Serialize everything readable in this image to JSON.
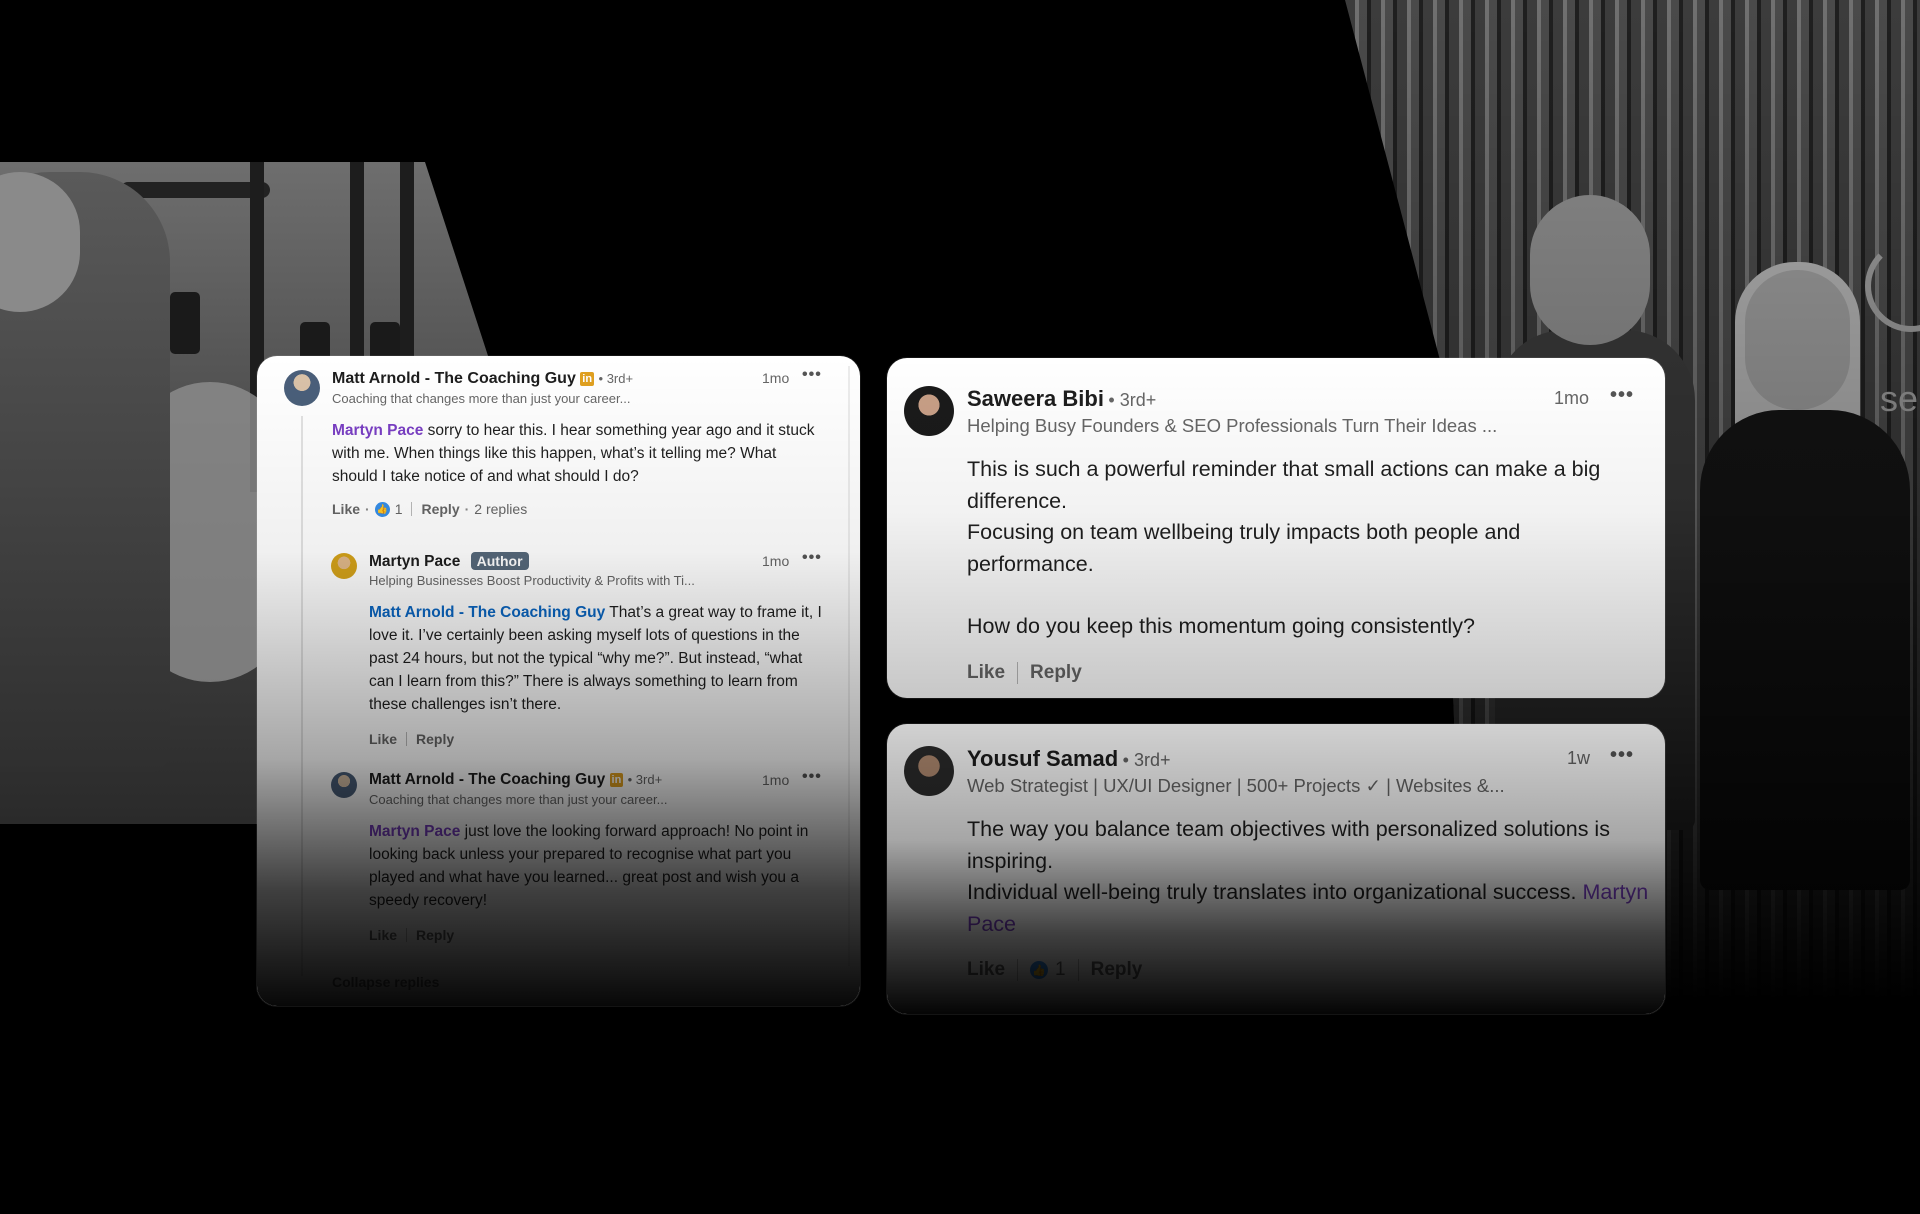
{
  "background": {
    "logo_text": "se"
  },
  "left_card": {
    "comment1": {
      "name": "Matt Arnold - The Coaching Guy",
      "linkedin_badge": "in",
      "degree": "• 3rd+",
      "headline": "Coaching that changes more than just your career...",
      "time": "1mo",
      "mention": "Martyn Pace",
      "text": " sorry to hear this. I hear something year ago and it stuck with me. When things like this happen, what’s it telling me? What should I take notice of and what should I do?",
      "like": "Like",
      "reaction_count": "1",
      "reply": "Reply",
      "replies": "2 replies"
    },
    "reply1": {
      "name": "Martyn Pace",
      "badge": "Author",
      "headline": "Helping Businesses Boost Productivity & Profits with Ti...",
      "time": "1mo",
      "mention": "Matt Arnold - The Coaching Guy",
      "text": " That’s a great way to frame it, I love it. I’ve certainly been asking myself lots of questions in the past 24 hours, but not the typical “why me?”. But instead, “what can I learn from this?” There is always something to learn from these challenges isn’t there.",
      "like": "Like",
      "reply": "Reply"
    },
    "reply2": {
      "name": "Matt Arnold - The Coaching Guy",
      "linkedin_badge": "in",
      "degree": "• 3rd+",
      "headline": "Coaching that changes more than just your career...",
      "time": "1mo",
      "mention": "Martyn Pace",
      "text": " just love the looking forward approach! No point in looking back unless your prepared to recognise what part you played and what have you learned... great post and wish you a speedy recovery!",
      "like": "Like",
      "reply": "Reply"
    },
    "collapse": "Collapse replies"
  },
  "right_top": {
    "name": "Saweera Bibi",
    "degree": "• 3rd+",
    "headline": "Helping Busy Founders & SEO Professionals Turn Their Ideas ...",
    "time": "1mo",
    "line1": "This is such a powerful reminder that small actions can make a big difference.",
    "line2": "Focusing on team wellbeing truly impacts both people and performance.",
    "line3": "How do you keep this momentum going consistently?",
    "like": "Like",
    "reply": "Reply"
  },
  "right_bottom": {
    "name": "Yousuf Samad",
    "degree": "• 3rd+",
    "headline": "Web Strategist | UX/UI Designer | 500+ Projects ✓ | Websites &...",
    "time": "1w",
    "line1": "The way you balance team objectives with personalized solutions is inspiring.",
    "line2": "Individual well-being truly translates into organizational success. ",
    "mention": "Martyn Pace",
    "like": "Like",
    "reaction_count": "1",
    "reply": "Reply"
  },
  "icons": {
    "more": "more-options-icon",
    "reaction": "like-reaction-icon",
    "linkedin": "linkedin-premium-icon"
  },
  "colors": {
    "mention_purple": "#7a3fc4",
    "mention_blue": "#0a66c2",
    "author_badge": "#56687a",
    "reaction_blue": "#378fe9",
    "premium_gold": "#e0a020"
  }
}
